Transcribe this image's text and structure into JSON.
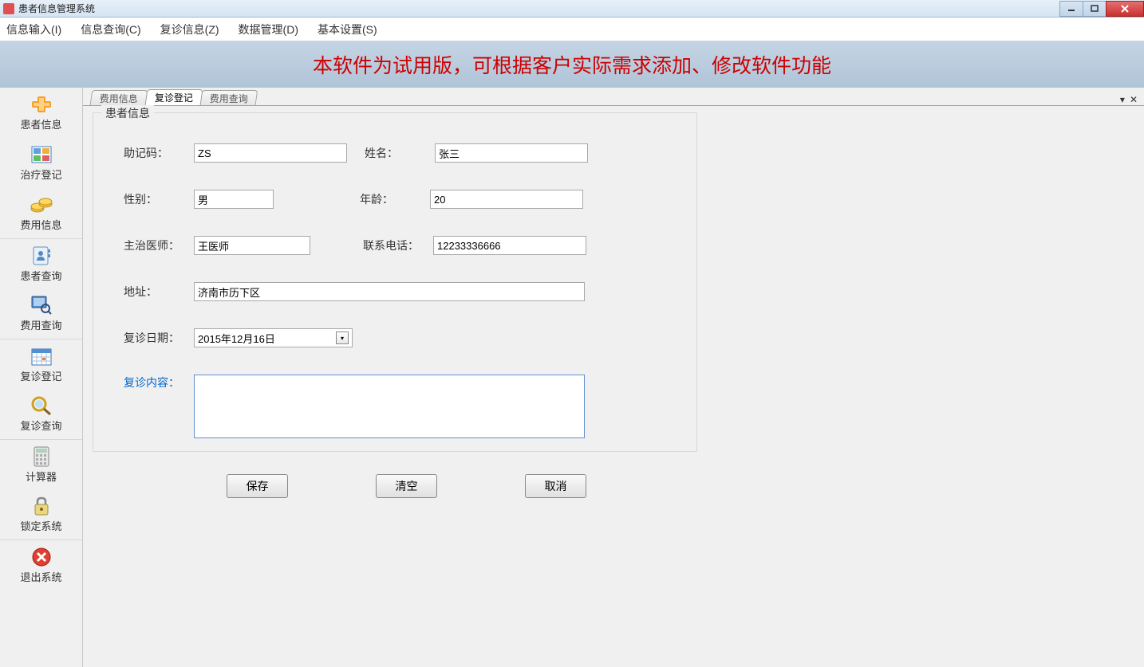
{
  "titlebar": {
    "title": "患者信息管理系统"
  },
  "menubar": {
    "items": [
      {
        "label": "信息输入(I)"
      },
      {
        "label": "信息查询(C)"
      },
      {
        "label": "复诊信息(Z)"
      },
      {
        "label": "数据管理(D)"
      },
      {
        "label": "基本设置(S)"
      }
    ]
  },
  "banner": {
    "text": "本软件为试用版，可根据客户实际需求添加、修改软件功能"
  },
  "sidebar": {
    "items": [
      {
        "label": "患者信息"
      },
      {
        "label": "治疗登记"
      },
      {
        "label": "费用信息"
      },
      {
        "label": "患者查询"
      },
      {
        "label": "费用查询"
      },
      {
        "label": "复诊登记"
      },
      {
        "label": "复诊查询"
      },
      {
        "label": "计算器"
      },
      {
        "label": "锁定系统"
      },
      {
        "label": "退出系统"
      }
    ]
  },
  "tabs": {
    "items": [
      {
        "label": "费用信息"
      },
      {
        "label": "复诊登记"
      },
      {
        "label": "费用查询"
      }
    ]
  },
  "form": {
    "group_title": "患者信息",
    "mnemonic_label": "助记码：",
    "mnemonic_value": "ZS",
    "name_label": "姓名：",
    "name_value": "张三",
    "gender_label": "性别：",
    "gender_value": "男",
    "age_label": "年龄：",
    "age_value": "20",
    "doctor_label": "主治医师：",
    "doctor_value": "王医师",
    "phone_label": "联系电话：",
    "phone_value": "12233336666",
    "address_label": "地址：",
    "address_value": "济南市历下区",
    "revisit_date_label": "复诊日期：",
    "revisit_date_value": "2015年12月16日",
    "content_label": "复诊内容：",
    "content_value": ""
  },
  "buttons": {
    "save": "保存",
    "clear": "清空",
    "cancel": "取消"
  }
}
